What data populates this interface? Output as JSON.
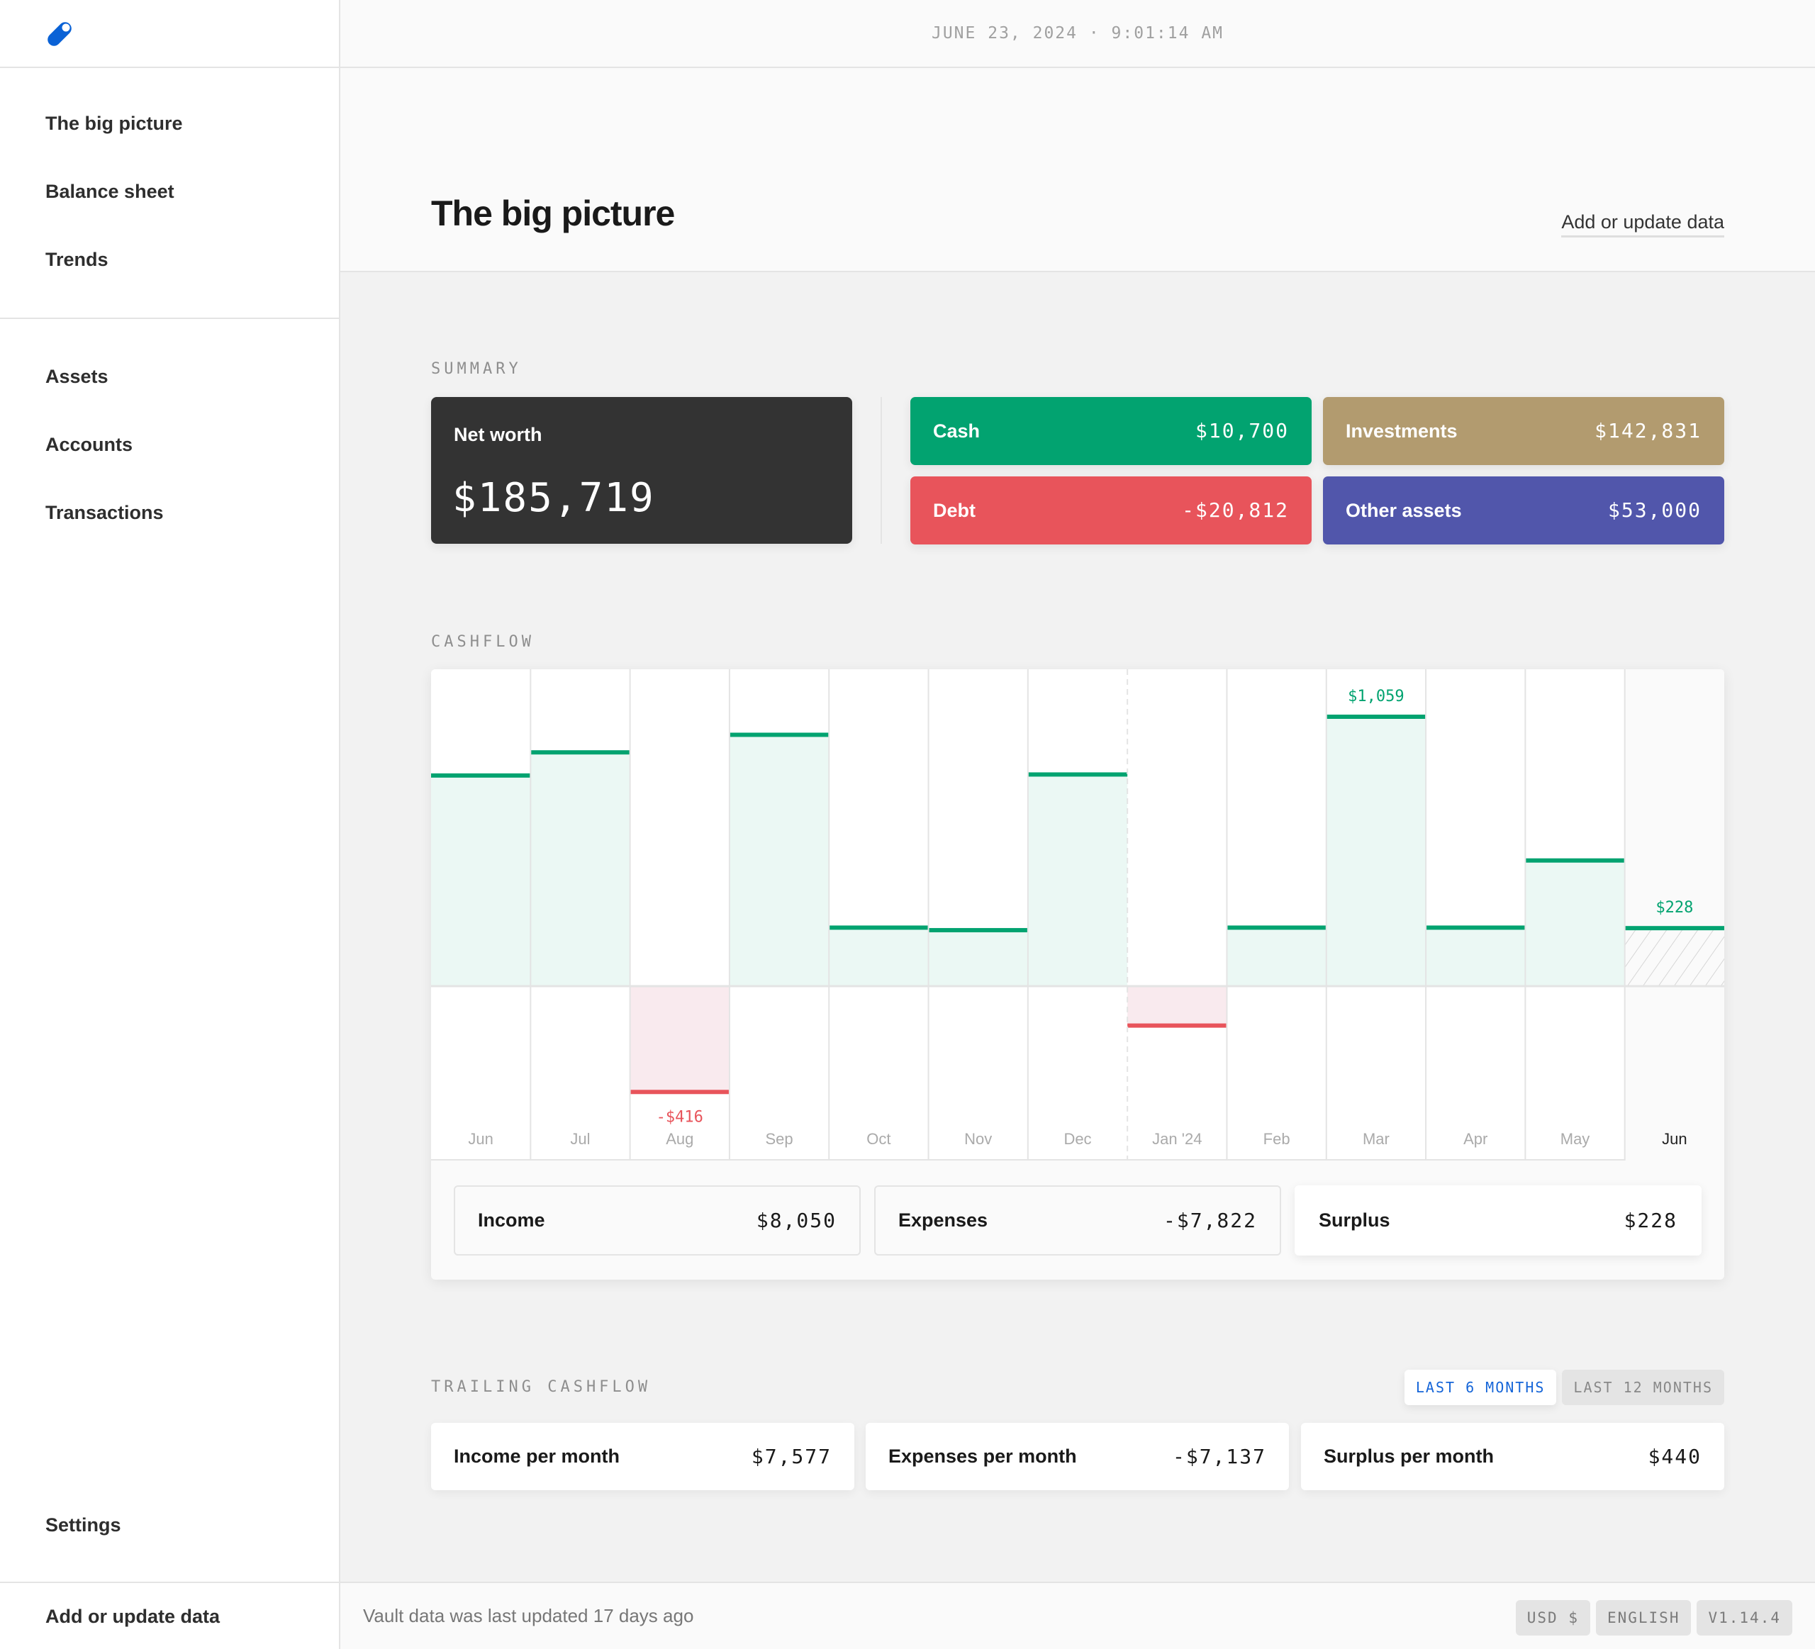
{
  "app": {
    "logo_icon": "pill-logo-icon",
    "accent": "#0a62d6"
  },
  "topbar": {
    "datetime": "JUNE 23, 2024 · 9:01:14 AM"
  },
  "sidebar": {
    "primary": [
      {
        "label": "The big picture"
      },
      {
        "label": "Balance sheet"
      },
      {
        "label": "Trends"
      }
    ],
    "secondary": [
      {
        "label": "Assets"
      },
      {
        "label": "Accounts"
      },
      {
        "label": "Transactions"
      }
    ],
    "settings": {
      "label": "Settings"
    },
    "footer": {
      "label": "Add or update data"
    }
  },
  "header": {
    "title": "The big picture",
    "action_label": "Add or update data"
  },
  "summary": {
    "label": "Summary",
    "net_worth": {
      "label": "Net worth",
      "value": "$185,719"
    },
    "cards": [
      {
        "label": "Cash",
        "value": "$10,700",
        "color": "#02a370"
      },
      {
        "label": "Investments",
        "value": "$142,831",
        "color": "#b29b6f"
      },
      {
        "label": "Debt",
        "value": "-$20,812",
        "color": "#e8545b"
      },
      {
        "label": "Other assets",
        "value": "$53,000",
        "color": "#5156ab"
      }
    ]
  },
  "cashflow": {
    "label": "Cashflow",
    "stats": [
      {
        "label": "Income",
        "value": "$8,050"
      },
      {
        "label": "Expenses",
        "value": "-$7,822"
      },
      {
        "label": "Surplus",
        "value": "$228"
      }
    ],
    "colors": {
      "positive_line": "#02a370",
      "positive_fill": "#ebf8f4",
      "negative_line": "#e8545b",
      "negative_fill": "#f9eaee",
      "positive_label": "#02a370",
      "negative_label": "#e8545b"
    }
  },
  "chart_data": {
    "type": "bar",
    "title": "Cashflow",
    "xlabel": "",
    "ylabel": "Surplus",
    "categories": [
      "Jun",
      "Jul",
      "Aug",
      "Sep",
      "Oct",
      "Nov",
      "Dec",
      "Jan '24",
      "Feb",
      "Mar",
      "Apr",
      "May",
      "Jun"
    ],
    "values": [
      828,
      919,
      -416,
      988,
      230,
      220,
      832,
      -155,
      230,
      1059,
      230,
      494,
      228
    ],
    "data_labels": [
      {
        "index": 2,
        "text": "-$416"
      },
      {
        "index": 9,
        "text": "$1,059"
      },
      {
        "index": 12,
        "text": "$228"
      }
    ],
    "current_index": 12,
    "year_boundary_index": 7,
    "ylim": [
      -560,
      1250
    ],
    "grid": true,
    "legend": "none"
  },
  "trailing": {
    "label": "Trailing cashflow",
    "toggles": [
      {
        "label": "LAST 6 MONTHS",
        "active": true
      },
      {
        "label": "LAST 12 MONTHS",
        "active": false
      }
    ],
    "cards": [
      {
        "label": "Income per month",
        "value": "$7,577"
      },
      {
        "label": "Expenses per month",
        "value": "-$7,137"
      },
      {
        "label": "Surplus per month",
        "value": "$440"
      }
    ]
  },
  "footer": {
    "status": "Vault data was last updated 17 days ago",
    "badges": [
      {
        "label": "USD $"
      },
      {
        "label": "ENGLISH"
      },
      {
        "label": "V1.14.4"
      }
    ]
  }
}
